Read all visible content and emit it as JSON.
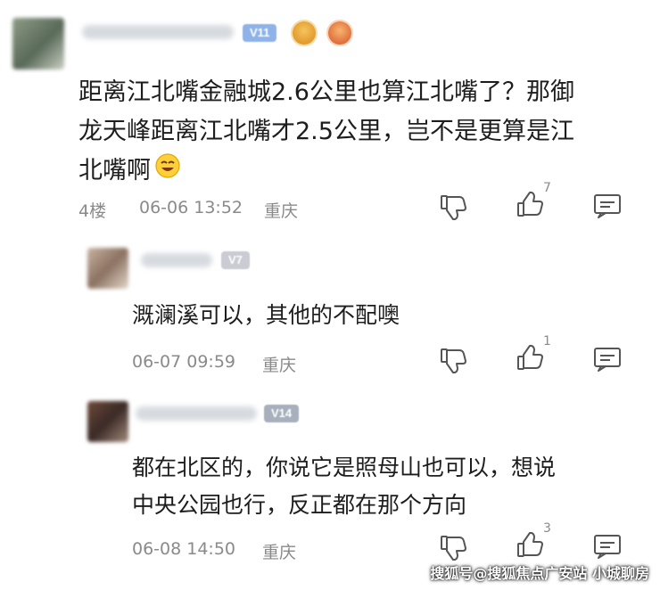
{
  "comment": {
    "level_badge": "V11",
    "text_lines": [
      "距离江北嘴金融城2.6公里也算江北嘴了？那御",
      "龙天峰距离江北嘴才2.5公里，岂不是更算是江",
      "北嘴啊"
    ],
    "floor": "4楼",
    "datetime": "06-06 13:52",
    "location": "重庆",
    "like_count": "7"
  },
  "replies": [
    {
      "level_badge": "V7",
      "text_lines": [
        "溉澜溪可以，其他的不配噢"
      ],
      "datetime": "06-07 09:59",
      "location": "重庆",
      "like_count": "1"
    },
    {
      "level_badge": "V14",
      "text_lines": [
        "都在北区的，你说它是照母山也可以，想说",
        "中央公园也行，反正都在那个方向"
      ],
      "datetime": "06-08 14:50",
      "location": "重庆",
      "like_count": "3"
    }
  ],
  "watermark": "搜狐号@搜狐焦点广安站 小城聊房",
  "colors": {
    "badge_v11": "#8fb3e8",
    "badge_v7": "#c9ccd2",
    "badge_v14": "#a8b0bd",
    "meta_text": "#8a8a8a"
  },
  "icons": [
    "dislike-icon",
    "like-icon",
    "comment-icon",
    "smile-emoji-icon"
  ]
}
